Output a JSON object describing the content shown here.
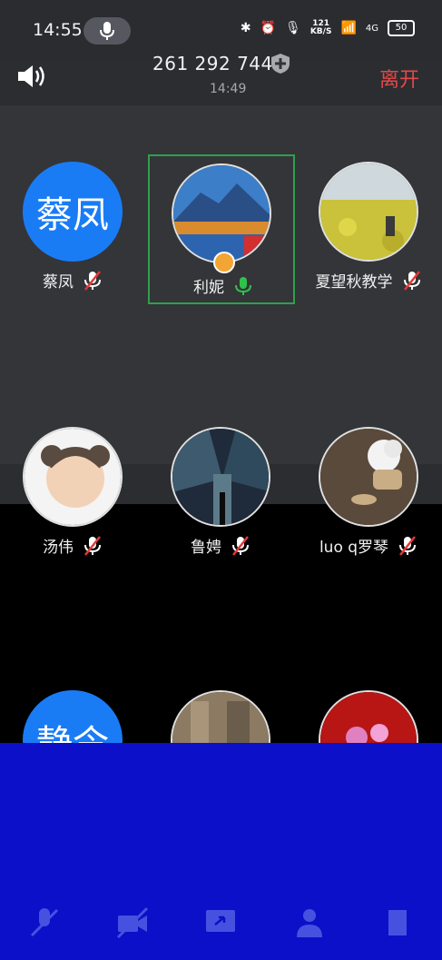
{
  "status_bar": {
    "time": "14:55",
    "speed_top": "121",
    "speed_bottom": "KB/S",
    "network": "4G",
    "battery": "50"
  },
  "header": {
    "meeting_id": "261 292 744",
    "elapsed": "14:49",
    "leave_label": "离开"
  },
  "participants": [
    {
      "name": "蔡凤",
      "avatar_text": "蔡凤",
      "mic": "muted"
    },
    {
      "name": "利妮",
      "avatar_text": "",
      "mic": "active",
      "host": true
    },
    {
      "name": "夏望秋教学",
      "avatar_text": "",
      "mic": "muted"
    },
    {
      "name": "汤伟",
      "avatar_text": "",
      "mic": "muted"
    },
    {
      "name": "鲁娉",
      "avatar_text": "",
      "mic": "muted"
    },
    {
      "name": "luo q罗琴",
      "avatar_text": "",
      "mic": "muted"
    },
    {
      "name": "",
      "avatar_text": "静令",
      "mic": "muted"
    },
    {
      "name": "",
      "avatar_text": "",
      "mic": "muted"
    },
    {
      "name": "",
      "avatar_text": "",
      "mic": "muted"
    }
  ],
  "colors": {
    "accent_blue": "#1a7cf5",
    "active_green": "#2fa04a",
    "leave_red": "#e64848",
    "muted_red": "#e53935"
  }
}
